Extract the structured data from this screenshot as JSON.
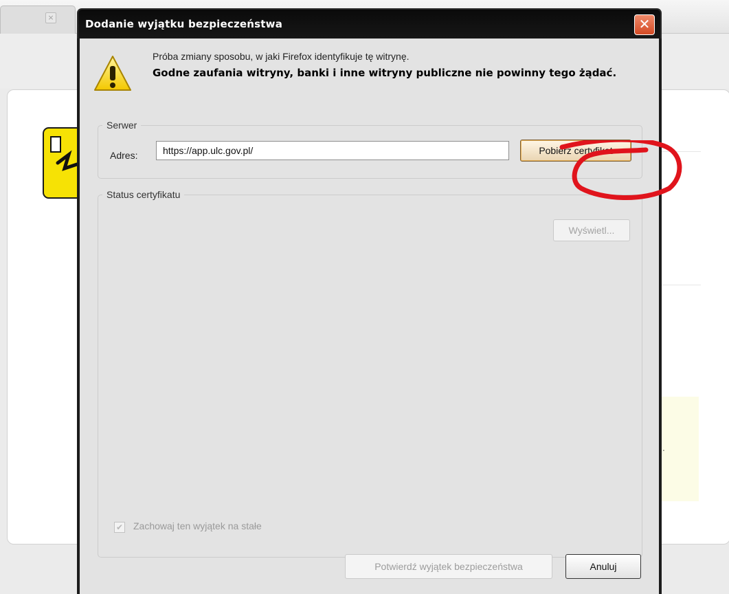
{
  "browser": {
    "tab_close_glyph": "×"
  },
  "dialog": {
    "title": "Dodanie wyjątku bezpieczeństwa",
    "close_glyph": "✕",
    "intro_text": "Próba zmiany sposobu, w jaki Firefox identyfikuje tę witrynę.",
    "warning_text": "Godne zaufania witryny, banki i inne witryny publiczne nie powinny tego żądać.",
    "server": {
      "legend": "Serwer",
      "address_label": "Adres:",
      "address_value": "https://app.ulc.gov.pl/",
      "get_certificate_button": "Pobierz certyfikat"
    },
    "certificate_status": {
      "legend": "Status certyfikatu",
      "view_button": "Wyświetl..."
    },
    "permanent_checkbox": {
      "label": "Zachowaj ten wyjątek na stałe",
      "checked": true,
      "enabled": false
    },
    "confirm_button": "Potwierdź wyjątek bezpieczeństwa",
    "cancel_button": "Anuluj"
  },
  "colors": {
    "titlebar": "#111111",
    "close_button": "#e0603c",
    "dialog_background": "#e3e3e3",
    "annotation": "#e0141c",
    "warning_yellow": "#f6e205"
  },
  "icons": {
    "warning": "warning-triangle-icon",
    "close": "close-icon",
    "check": "check-icon"
  }
}
